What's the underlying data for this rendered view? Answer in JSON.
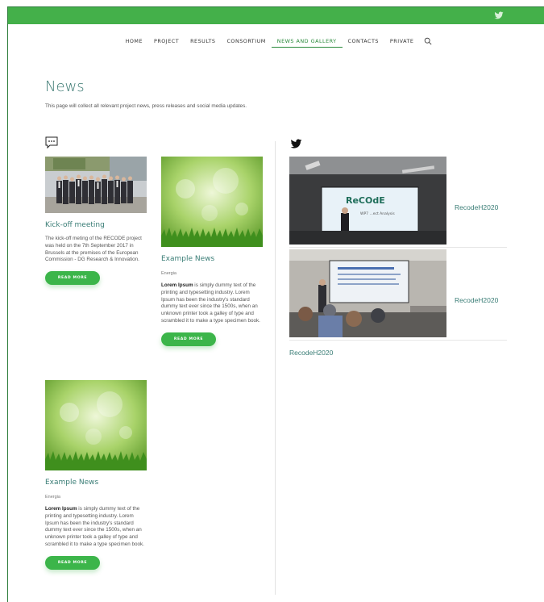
{
  "nav": {
    "items": [
      "HOME",
      "PROJECT",
      "RESULTS",
      "CONSORTIUM",
      "NEWS AND GALLERY",
      "CONTACTS",
      "PRIVATE"
    ],
    "active": "NEWS AND GALLERY"
  },
  "page": {
    "title": "News",
    "description": "This page will collect all relevant project news, press releases and social media updates."
  },
  "news": [
    {
      "title": "Kick-off meeting",
      "body": "The kick-off meting of the RECODE project was held on the 7th September 2017 in Brussels at the premises of the European Commission - DG Research & Innovation.",
      "button": "READ MORE"
    },
    {
      "title": "Example News",
      "category": "Energia",
      "body_bold": "Lorem Ipsum",
      "body": " is simply dummy text of the printing and typesetting industry. Lorem Ipsum has been the industry's standard dummy text ever since the 1500s, when an unknown printer took a galley of type and scrambled it to make a type specimen book.",
      "button": "READ MORE"
    },
    {
      "title": "Example News",
      "category": "Energia",
      "body_bold": "Lorem Ipsum",
      "body": " is simply dummy text of the printing and typesetting industry. Lorem Ipsum has been the industry's standard dummy text ever since the 1500s, when an unknown printer took a galley of type and scrambled it to make a type specimen book.",
      "button": "READ MORE"
    }
  ],
  "twitter": {
    "tweets": [
      {
        "handle": "RecodeH2020",
        "slide_title": "ReCOdE",
        "slide_sub": "WP7 ...ect Analysis"
      },
      {
        "handle": "RecodeH2020"
      }
    ],
    "footer_handle": "RecodeH2020"
  },
  "colors": {
    "topbar": "#44b04a",
    "accent_text": "#3a7d76",
    "button": "#3cb54a"
  }
}
